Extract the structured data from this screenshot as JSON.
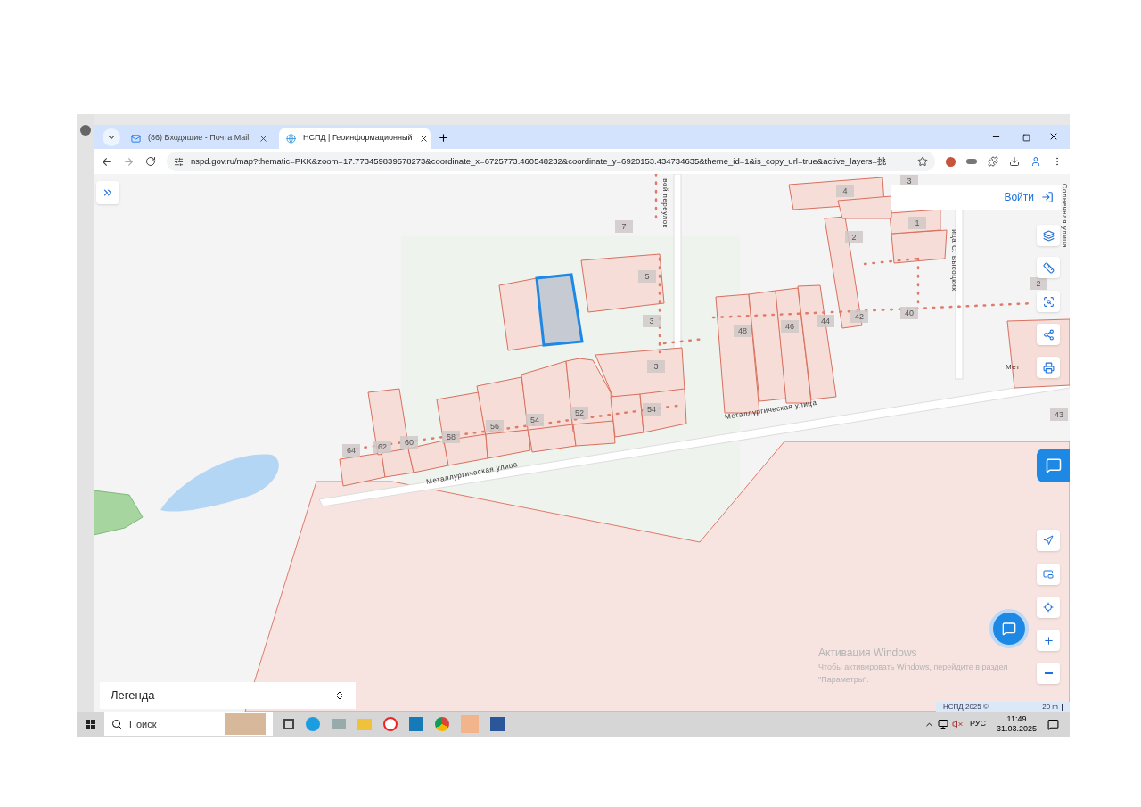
{
  "browser": {
    "tabs": [
      {
        "title": "(86) Входящие - Почта Mail",
        "selected": false
      },
      {
        "title": "НСПД | Геоинформационный",
        "selected": true
      }
    ],
    "url": "nspd.gov.ru/map?thematic=PKK&zoom=17.773459839578273&coordinate_x=6725773.460548232&coordinate_y=6920153.434734635&theme_id=1&is_copy_url=true&active_layers=挑"
  },
  "map": {
    "login": "Войти",
    "legend": "Легенда",
    "street_labels": [
      {
        "text": "Металлургическая улица"
      },
      {
        "text": "Металлургическая улица"
      },
      {
        "text": "вой переулок"
      },
      {
        "text": "ица С. Высоцких"
      },
      {
        "text": "Солнечная улица"
      },
      {
        "text": "Мет"
      }
    ],
    "house_numbers": [
      {
        "label": "7"
      },
      {
        "label": "5"
      },
      {
        "label": "3"
      },
      {
        "label": "3"
      },
      {
        "label": "54"
      },
      {
        "label": "52"
      },
      {
        "label": "54"
      },
      {
        "label": "56"
      },
      {
        "label": "58"
      },
      {
        "label": "60"
      },
      {
        "label": "62"
      },
      {
        "label": "64"
      },
      {
        "label": "48"
      },
      {
        "label": "46"
      },
      {
        "label": "44"
      },
      {
        "label": "42"
      },
      {
        "label": "40"
      },
      {
        "label": "2"
      },
      {
        "label": "4"
      },
      {
        "label": "1"
      },
      {
        "label": "3"
      },
      {
        "label": "2"
      },
      {
        "label": "43"
      }
    ],
    "attribution": "НСПД 2025 ©",
    "scale": "20 m"
  },
  "activation": {
    "title": "Активация Windows",
    "text": "Чтобы активировать Windows, перейдите в раздел \"Параметры\"."
  },
  "taskbar": {
    "search_placeholder": "Поиск",
    "language": "РУС",
    "time": "11:49",
    "date": "31.03.2025"
  }
}
